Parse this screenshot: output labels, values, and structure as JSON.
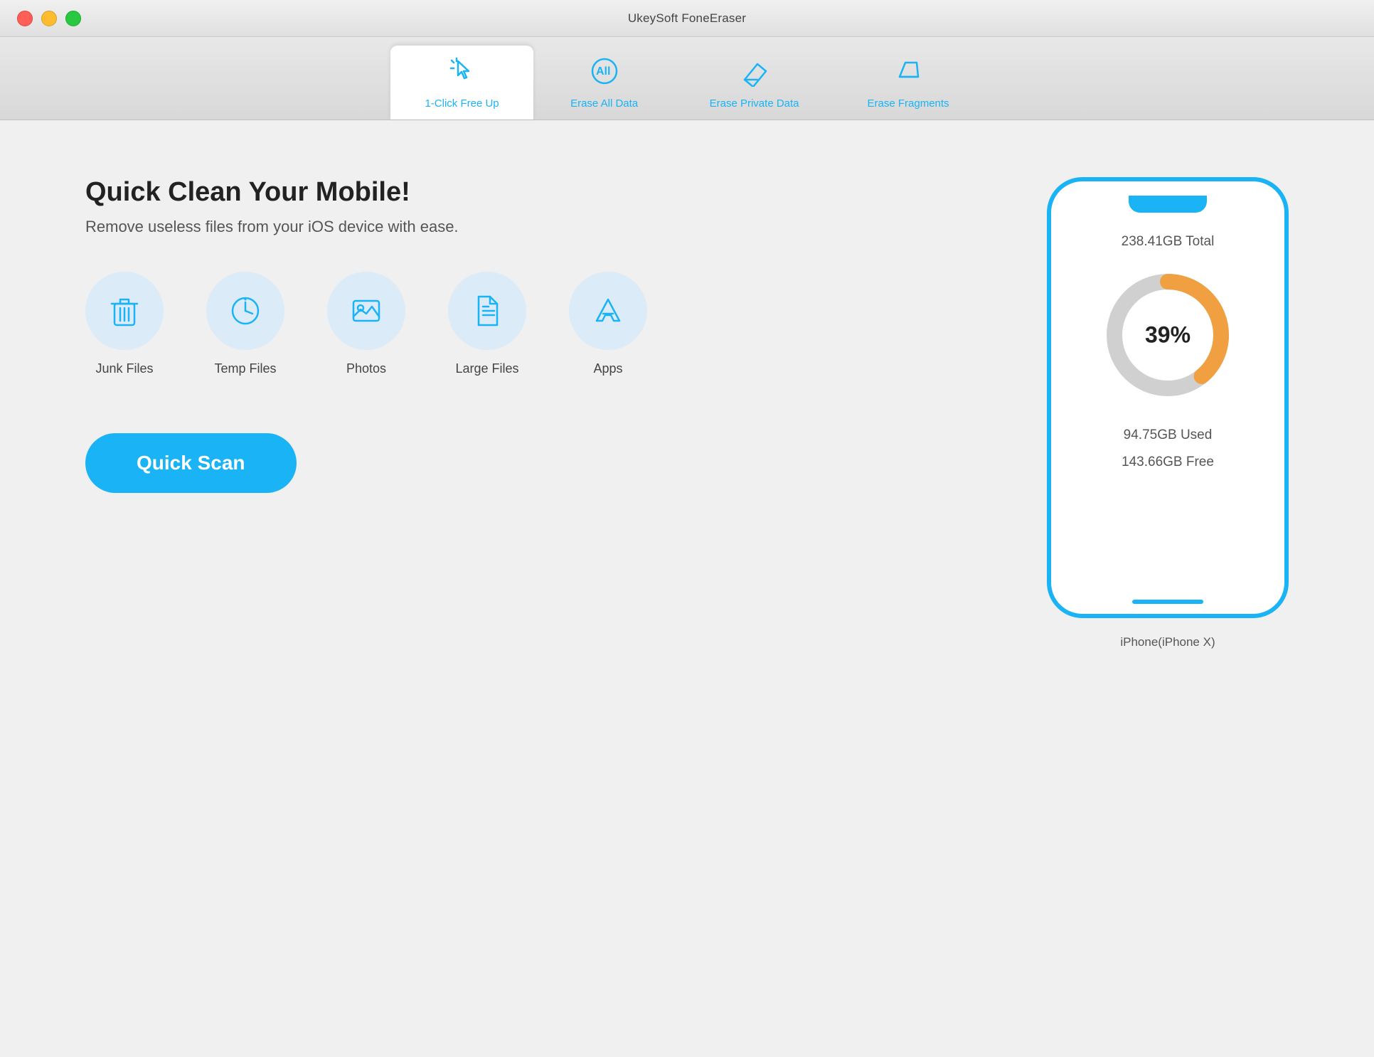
{
  "window": {
    "title": "UkeySoft FoneEraser"
  },
  "tabs": [
    {
      "id": "one-click",
      "label": "1-Click Free Up",
      "active": true
    },
    {
      "id": "erase-all",
      "label": "Erase All Data",
      "active": false
    },
    {
      "id": "erase-private",
      "label": "Erase Private Data",
      "active": false
    },
    {
      "id": "erase-fragments",
      "label": "Erase Fragments",
      "active": false
    }
  ],
  "main": {
    "headline": "Quick Clean Your Mobile!",
    "subtext": "Remove useless files from your iOS device with ease.",
    "icons": [
      {
        "id": "junk-files",
        "label": "Junk Files"
      },
      {
        "id": "temp-files",
        "label": "Temp Files"
      },
      {
        "id": "photos",
        "label": "Photos"
      },
      {
        "id": "large-files",
        "label": "Large Files"
      },
      {
        "id": "apps",
        "label": "Apps"
      }
    ],
    "scan_button": "Quick Scan"
  },
  "device": {
    "total": "238.41GB Total",
    "used": "94.75GB Used",
    "free": "143.66GB Free",
    "percent": 39,
    "name": "iPhone(iPhone X)"
  },
  "colors": {
    "blue": "#1ab3f5",
    "orange": "#f0a040",
    "gray": "#d0d0d0"
  }
}
